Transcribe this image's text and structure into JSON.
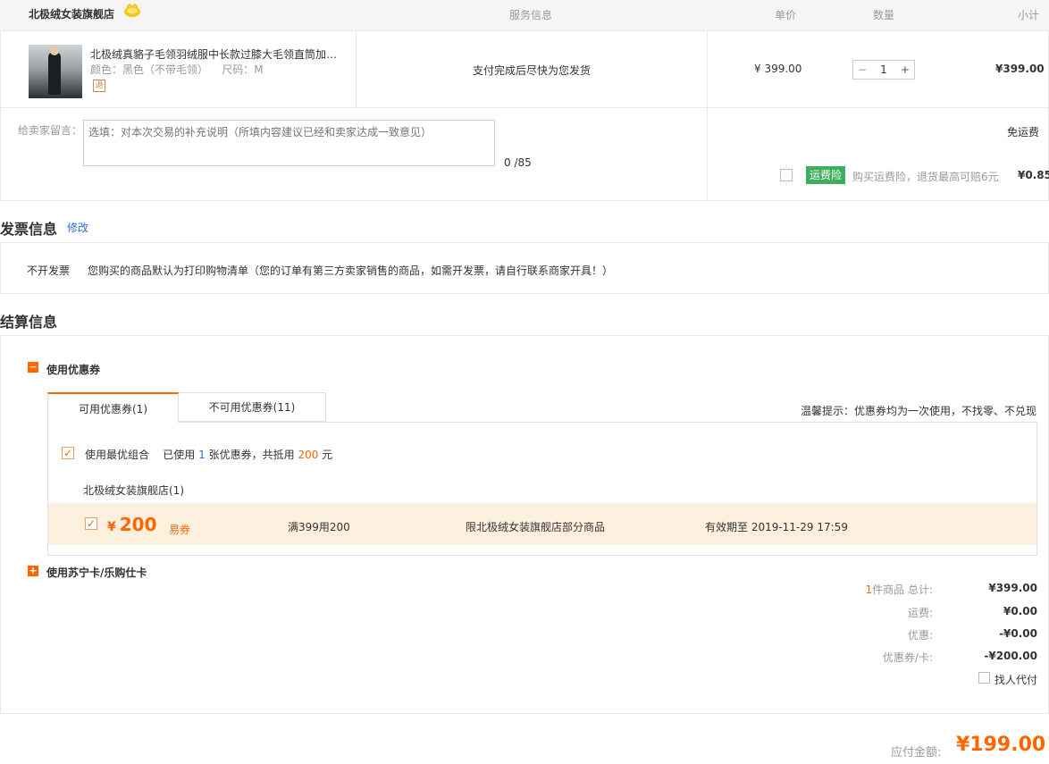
{
  "header": {
    "store_name": "北极绒女装旗舰店",
    "col_service": "服务信息",
    "col_price": "单价",
    "col_qty": "数量",
    "col_subtotal": "小计"
  },
  "product": {
    "title": "北极绒真貉子毛领羽绒服中长款过膝大毛领直筒加…",
    "spec": "颜色：黑色（不带毛领）    尺码：M",
    "return_badge": "退",
    "service": "支付完成后尽快为您发货",
    "unit_price": "¥ 399.00",
    "qty_minus": "−",
    "qty_value": "1",
    "qty_plus": "+",
    "subtotal": "¥399.00"
  },
  "message": {
    "label": "给卖家留言：",
    "placeholder": "选填：对本次交易的补充说明（所填内容建议已经和卖家达成一致意见）",
    "count": "0 /85"
  },
  "shipping": {
    "free": "免运费",
    "insurance_tag": "运费险",
    "insurance_desc": "购买运费险，退货最高可赔6元",
    "insurance_price": "¥0.85"
  },
  "invoice": {
    "title": "发票信息",
    "edit": "修改",
    "type": "不开发票",
    "desc": "您购买的商品默认为打印购物清单（您的订单有第三方卖家销售的商品，如需开发票，请自行联系商家开具！）"
  },
  "settlement": {
    "title": "结算信息",
    "coupon_section": "使用优惠券",
    "coupon_toggle": "−",
    "tab_available": "可用优惠券(1)",
    "tab_unavailable": "不可用优惠券(11)",
    "tip": "温馨提示：优惠券均为一次使用，不找零、不兑现",
    "best_combo": "使用最优组合",
    "best_used_pre": "已使用",
    "best_used_count": "1",
    "best_used_mid": "张优惠券，共抵用",
    "best_used_amount": "200",
    "best_used_post": "元",
    "shop_sub": "北极绒女装旗舰店(1)",
    "coupon": {
      "yen": "¥",
      "amount": "200",
      "type": "易券",
      "rule": "满399用200",
      "scope": "限北极绒女装旗舰店部分商品",
      "expiry": "有效期至 2019-11-29 17:59"
    },
    "card_section": "使用苏宁卡/乐购仕卡",
    "card_toggle": "+"
  },
  "summary": {
    "count": "1",
    "items_label": "件商品 总计:",
    "items_total": "¥399.00",
    "freight_label": "运费:",
    "freight": "¥0.00",
    "discount_label": "优惠:",
    "discount": "-¥0.00",
    "coupon_label": "优惠券/卡:",
    "coupon": "-¥200.00",
    "proxy_pay": "找人代付",
    "pay_label": "应付金额:",
    "pay_total": "¥199.00"
  },
  "colors": {
    "accent": "#ff6600",
    "insurance_green": "#3dae5c",
    "coupon_bg": "#fdf0de",
    "link_blue": "#2a6fd6"
  }
}
